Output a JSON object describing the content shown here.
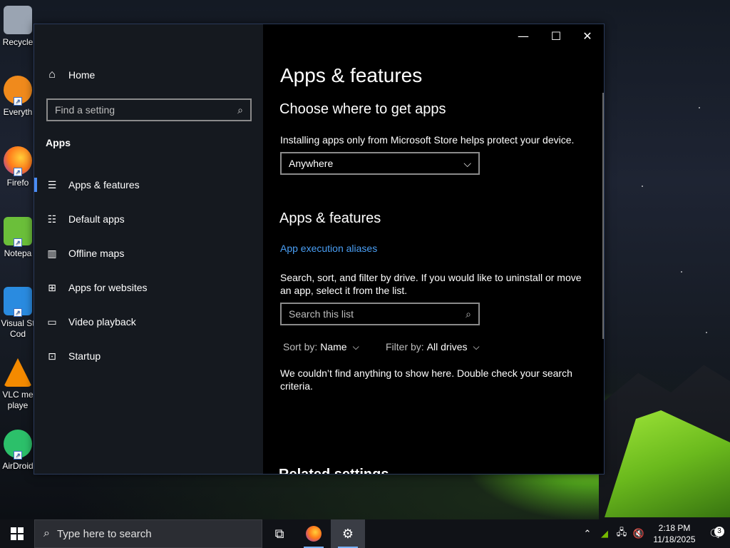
{
  "desktop": {
    "icons": [
      {
        "label": "Recycle",
        "color": "#9aa4b2"
      },
      {
        "label": "Everyth",
        "color": "#f08a1c"
      },
      {
        "label": "Firefo",
        "color": "#ff7b1a"
      },
      {
        "label": "Notepa",
        "color": "#6bbf3a"
      },
      {
        "label1": "Visual St",
        "label2": "Cod",
        "color": "#2a8be0"
      },
      {
        "label1": "VLC me",
        "label2": "playe",
        "color": "#f48a00"
      },
      {
        "label": "AirDroid",
        "color": "#2cc06a"
      }
    ]
  },
  "window": {
    "minimize": "—",
    "maximize": "☐",
    "close": "✕"
  },
  "sidebar": {
    "home": "Home",
    "find_placeholder": "Find a setting",
    "section": "Apps",
    "items": [
      {
        "label": "Apps & features",
        "icon": "list-icon"
      },
      {
        "label": "Default apps",
        "icon": "default-apps-icon"
      },
      {
        "label": "Offline maps",
        "icon": "map-icon"
      },
      {
        "label": "Apps for websites",
        "icon": "web-app-icon"
      },
      {
        "label": "Video playback",
        "icon": "video-icon"
      },
      {
        "label": "Startup",
        "icon": "startup-icon"
      }
    ]
  },
  "content": {
    "title": "Apps & features",
    "choose_heading": "Choose where to get apps",
    "choose_desc": "Installing apps only from Microsoft Store helps protect your device.",
    "dropdown_value": "Anywhere",
    "features_heading": "Apps & features",
    "aliases_link": "App execution aliases",
    "search_desc": "Search, sort, and filter by drive. If you would like to uninstall or move an app, select it from the list.",
    "search_placeholder": "Search this list",
    "sort_label": "Sort by:",
    "sort_value": "Name",
    "filter_label": "Filter by:",
    "filter_value": "All drives",
    "empty_message": "We couldn’t find anything to show here. Double check your search criteria.",
    "related_heading": "Related settings"
  },
  "taskbar": {
    "search_placeholder": "Type here to search",
    "time": "2:18 PM",
    "date": "11/18/2025",
    "notifications_count": "3"
  }
}
